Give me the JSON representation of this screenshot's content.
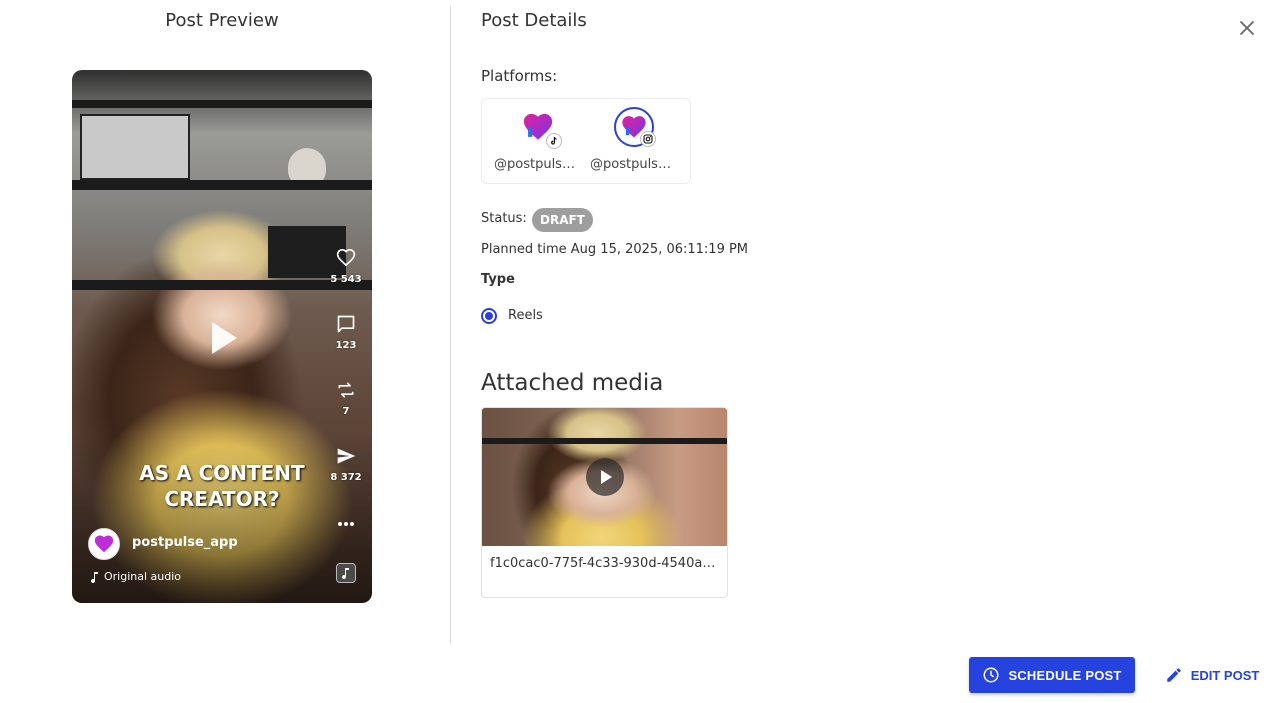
{
  "preview": {
    "title": "Post Preview",
    "caption_line1": "AS A CONTENT",
    "caption_line2": "CREATOR?",
    "username": "postpulse_app",
    "audio": "Original audio",
    "likes": "5 543",
    "comments": "123",
    "reposts": "7",
    "shares": "8 372"
  },
  "details": {
    "title": "Post Details",
    "platforms_label": "Platforms:",
    "platforms": [
      {
        "handle": "@postpulse.…",
        "network_icon": "tiktok-icon",
        "selected": false
      },
      {
        "handle": "@postpulse_…",
        "network_icon": "instagram-icon",
        "selected": true
      }
    ],
    "status_label": "Status:",
    "status": "DRAFT",
    "planned_time": "Planned time Aug 15, 2025, 06:11:19 PM",
    "type_label": "Type",
    "type_option": "Reels",
    "attached_media_title": "Attached media",
    "media_filename": "f1c0cac0-775f-4c33-930d-4540a…"
  },
  "actions": {
    "schedule": "SCHEDULE POST",
    "edit": "EDIT POST"
  },
  "colors": {
    "accent": "#2643e0",
    "status_chip": "#9e9e9e",
    "brand_pink": "#e0219a",
    "brand_purple": "#7a35e8"
  }
}
